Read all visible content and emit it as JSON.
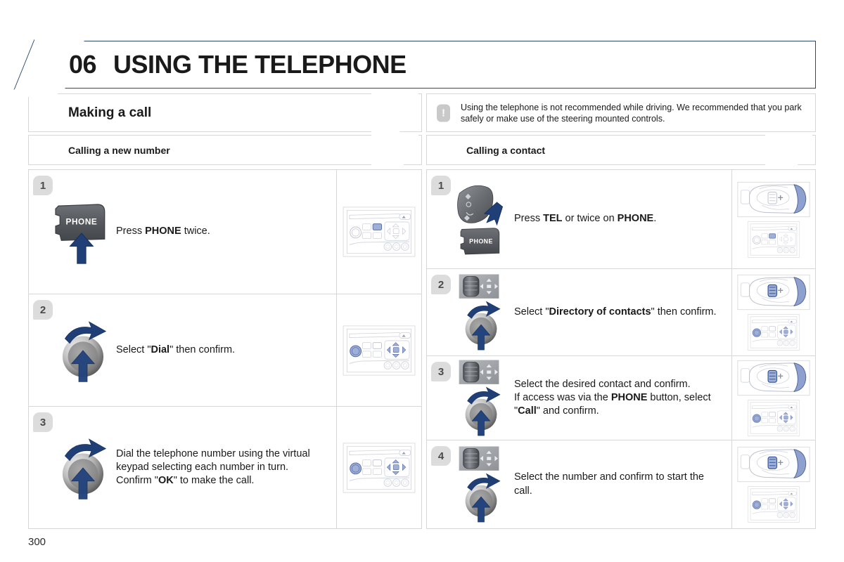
{
  "chapter": {
    "number": "06",
    "title": "USING THE TELEPHONE"
  },
  "section": {
    "title": "Making a call"
  },
  "warning": {
    "icon": "exclamation-icon",
    "text": "Using the telephone is not recommended while driving. We recommended that you park safely or make use of the steering mounted controls."
  },
  "columns": [
    {
      "id": "calling-a-new-number",
      "heading": "Calling a new number",
      "steps": [
        {
          "number": "1",
          "art": "phone-button",
          "lines": [
            [
              {
                "t": "Press ",
                "b": false
              },
              {
                "t": "PHONE",
                "b": true
              },
              {
                "t": " twice.",
                "b": false
              }
            ]
          ],
          "thumbs": [
            "radio-panel-phone-highlight"
          ]
        },
        {
          "number": "2",
          "art": "rotary-knob",
          "lines": [
            [
              {
                "t": "Select \"",
                "b": false
              },
              {
                "t": "Dial",
                "b": true
              },
              {
                "t": "\" then confirm.",
                "b": false
              }
            ]
          ],
          "thumbs": [
            "radio-panel-knob-highlight"
          ]
        },
        {
          "number": "3",
          "art": "rotary-knob",
          "lines": [
            [
              {
                "t": "Dial the telephone number using the virtual keypad selecting each number in turn.",
                "b": false
              }
            ],
            [
              {
                "t": "Confirm \"",
                "b": false
              },
              {
                "t": "OK",
                "b": true
              },
              {
                "t": "\" to make the call.",
                "b": false
              }
            ]
          ],
          "thumbs": [
            "radio-panel-knob-highlight"
          ]
        }
      ]
    },
    {
      "id": "calling-a-contact",
      "heading": "Calling a contact",
      "steps": [
        {
          "number": "1",
          "art": "steering-stalk-and-phone-button",
          "lines": [
            [
              {
                "t": "Press ",
                "b": false
              },
              {
                "t": "TEL",
                "b": true
              },
              {
                "t": " or twice on ",
                "b": false
              },
              {
                "t": "PHONE",
                "b": true
              },
              {
                "t": ".",
                "b": false
              }
            ]
          ],
          "thumbs": [
            "steering-stalk",
            "radio-panel-phone-highlight"
          ]
        },
        {
          "number": "2",
          "art": "thumbwheel-and-knob",
          "lines": [
            [
              {
                "t": "Select \"",
                "b": false
              },
              {
                "t": "Directory of contacts",
                "b": true
              },
              {
                "t": "\" then confirm.",
                "b": false
              }
            ]
          ],
          "thumbs": [
            "steering-stalk-wheel-highlight",
            "radio-panel-knob-highlight"
          ]
        },
        {
          "number": "3",
          "art": "thumbwheel-and-knob",
          "lines": [
            [
              {
                "t": "Select the desired contact and confirm.",
                "b": false
              }
            ],
            [
              {
                "t": "If access was via the ",
                "b": false
              },
              {
                "t": "PHONE",
                "b": true
              },
              {
                "t": " button, select \"",
                "b": false
              },
              {
                "t": "Call",
                "b": true
              },
              {
                "t": "\" and confirm.",
                "b": false
              }
            ]
          ],
          "thumbs": [
            "steering-stalk-wheel-highlight",
            "radio-panel-knob-highlight"
          ]
        },
        {
          "number": "4",
          "art": "thumbwheel-and-knob",
          "lines": [
            [
              {
                "t": "Select the number and confirm to start the call.",
                "b": false
              }
            ]
          ],
          "thumbs": [
            "steering-stalk-wheel-highlight",
            "radio-panel-knob-highlight"
          ]
        }
      ]
    }
  ],
  "footer": {
    "page_number": "300"
  },
  "colors": {
    "accent_blue": "#1f3f76",
    "header_border": "#2e4a6b",
    "badge_gray": "#dcdcdc",
    "rule_gray": "#d7d7d7",
    "highlight_blue": "#9fb0d8"
  }
}
